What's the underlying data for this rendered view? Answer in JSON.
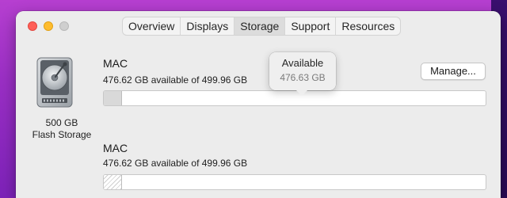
{
  "tabs": [
    {
      "label": "Overview"
    },
    {
      "label": "Displays"
    },
    {
      "label": "Storage"
    },
    {
      "label": "Support"
    },
    {
      "label": "Resources"
    }
  ],
  "active_tab": "Storage",
  "disk": {
    "icon": "hard-drive-icon",
    "size": "500 GB",
    "type": "Flash Storage"
  },
  "volumes": [
    {
      "name": "MAC",
      "available_text": "476.62 GB available of 499.96 GB",
      "used_fraction": 0.047
    },
    {
      "name": "MAC",
      "available_text": "476.62 GB available of 499.96 GB",
      "used_fraction": 0.047
    }
  ],
  "manage_button": {
    "label": "Manage..."
  },
  "tooltip": {
    "title": "Available",
    "value": "476.63 GB"
  },
  "colors": {
    "close": "#ff5f57",
    "minimize": "#febc2e",
    "zoom": "#cfcfcf"
  }
}
